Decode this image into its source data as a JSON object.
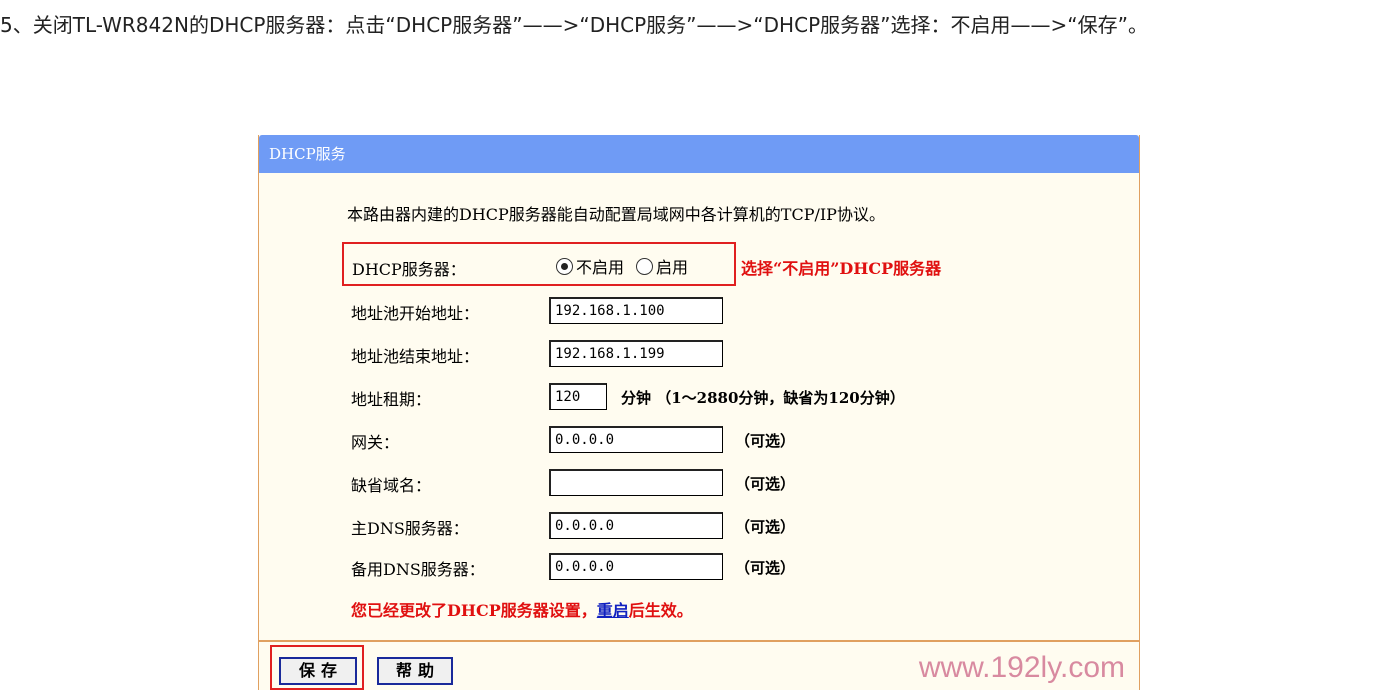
{
  "article": {
    "text": "5、关闭TL-WR842N的DHCP服务器：点击“DHCP服务器”——>“DHCP服务”——>“DHCP服务器”选择：不启用——>“保存”。"
  },
  "panel": {
    "title": "DHCP服务",
    "intro": "本路由器内建的DHCP服务器能自动配置局域网中各计算机的TCP/IP协议。",
    "dhcp_server": {
      "label": "DHCP服务器：",
      "options": [
        {
          "label": "不启用",
          "checked": true
        },
        {
          "label": "启用",
          "checked": false
        }
      ],
      "annotation": "选择“不启用”DHCP服务器"
    },
    "fields": {
      "pool_start": {
        "label": "地址池开始地址：",
        "value": "192.168.1.100"
      },
      "pool_end": {
        "label": "地址池结束地址：",
        "value": "192.168.1.199"
      },
      "lease": {
        "label": "地址租期：",
        "value": "120",
        "suffix": "分钟 （1～2880分钟，缺省为120分钟）"
      },
      "gateway": {
        "label": "网关：",
        "value": "0.0.0.0",
        "suffix": "（可选）"
      },
      "domain": {
        "label": "缺省域名：",
        "value": "",
        "suffix": "（可选）"
      },
      "primary_dns": {
        "label": "主DNS服务器：",
        "value": "0.0.0.0",
        "suffix": "（可选）"
      },
      "secondary_dns": {
        "label": "备用DNS服务器：",
        "value": "0.0.0.0",
        "suffix": "（可选）"
      }
    },
    "warning": {
      "before": "您已经更改了DHCP服务器设置，",
      "link": "重启",
      "after": "后生效。"
    },
    "buttons": {
      "save": "保存",
      "help": "帮助"
    },
    "watermark": "www.192ly.com"
  },
  "colors": {
    "header_bg": "#6f9bf5",
    "panel_bg": "#fffcf0",
    "highlight_red": "#e02020",
    "link_blue": "#1020c0"
  }
}
